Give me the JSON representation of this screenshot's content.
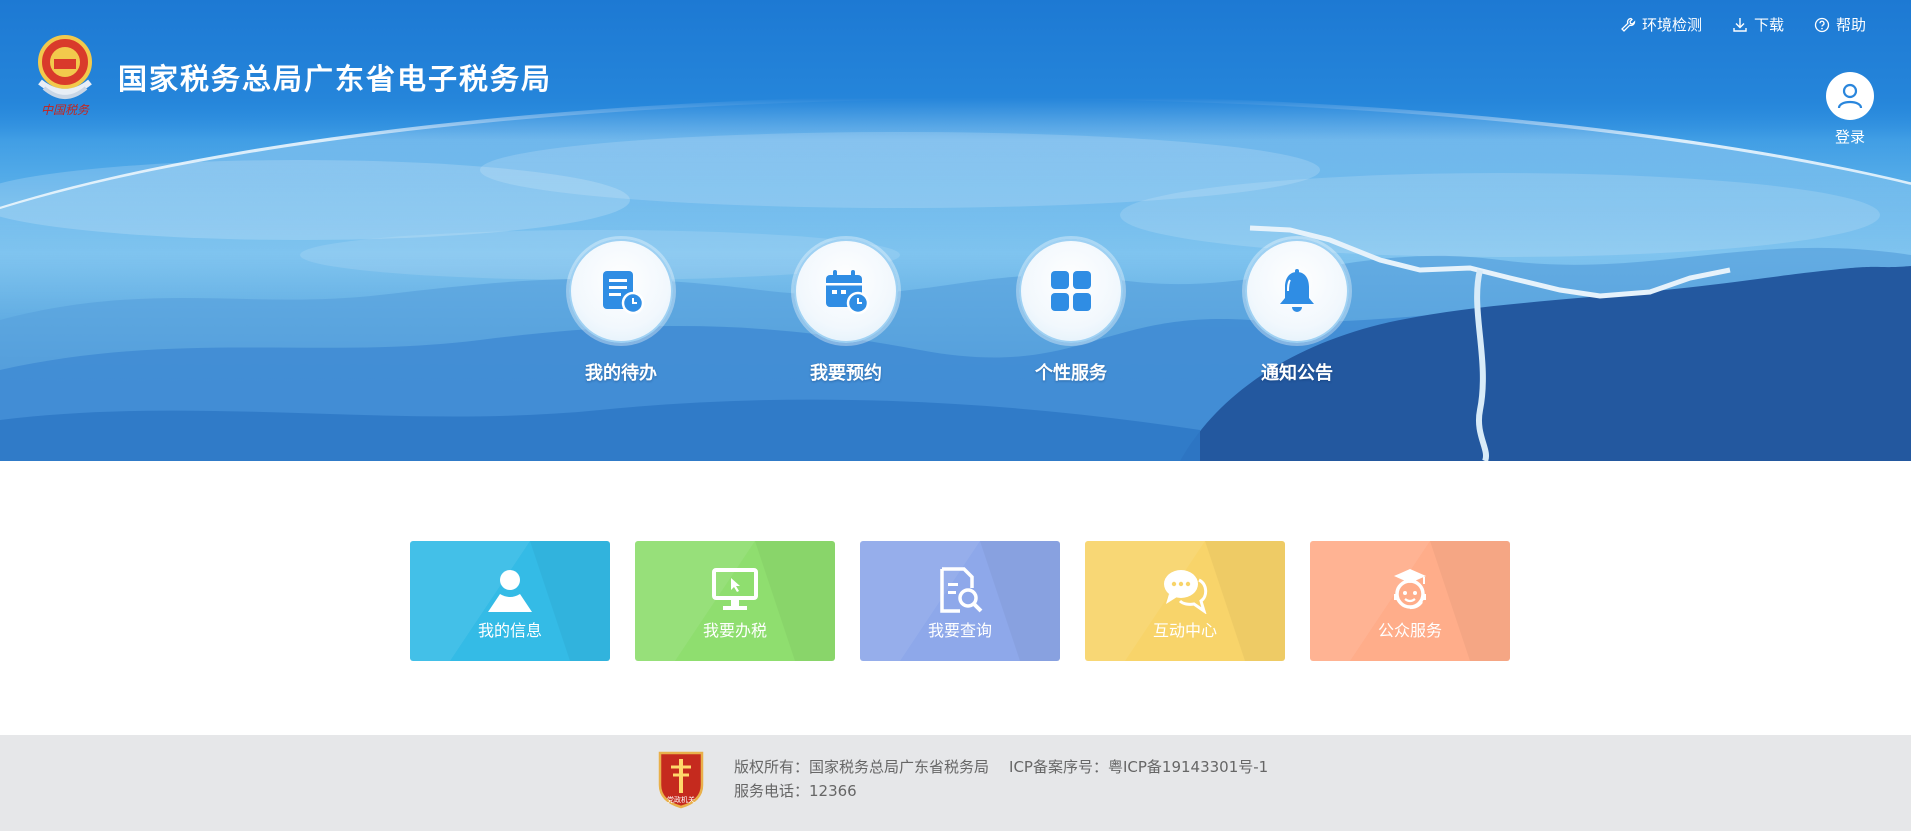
{
  "header": {
    "title": "国家税务总局广东省电子税务局",
    "emblem_icon": "tax-emblem-icon",
    "emblem_text": "中国税务",
    "links": [
      {
        "label": "环境检测",
        "icon": "wrench-icon"
      },
      {
        "label": "下载",
        "icon": "download-icon"
      },
      {
        "label": "帮助",
        "icon": "help-icon"
      }
    ],
    "login_label": "登录"
  },
  "quick_services": [
    {
      "label": "我的待办",
      "icon": "todo-list-icon"
    },
    {
      "label": "我要预约",
      "icon": "calendar-clock-icon"
    },
    {
      "label": "个性服务",
      "icon": "grid-apps-icon"
    },
    {
      "label": "通知公告",
      "icon": "bell-icon"
    }
  ],
  "tiles": [
    {
      "label": "我的信息",
      "icon": "user-icon",
      "color": "#34bbe6"
    },
    {
      "label": "我要办税",
      "icon": "monitor-icon",
      "color": "#8fde6f"
    },
    {
      "label": "我要查询",
      "icon": "document-search-icon",
      "color": "#8ea8ea"
    },
    {
      "label": "互动中心",
      "icon": "chat-bubbles-icon",
      "color": "#f8d46a"
    },
    {
      "label": "公众服务",
      "icon": "service-agent-icon",
      "color": "#ffad8a"
    }
  ],
  "footer": {
    "copyright": "版权所有：国家税务总局广东省税务局",
    "icp": "ICP备案序号：粤ICP备19143301号-1",
    "phone": "服务电话：12366",
    "badge_text": "党政机关"
  }
}
